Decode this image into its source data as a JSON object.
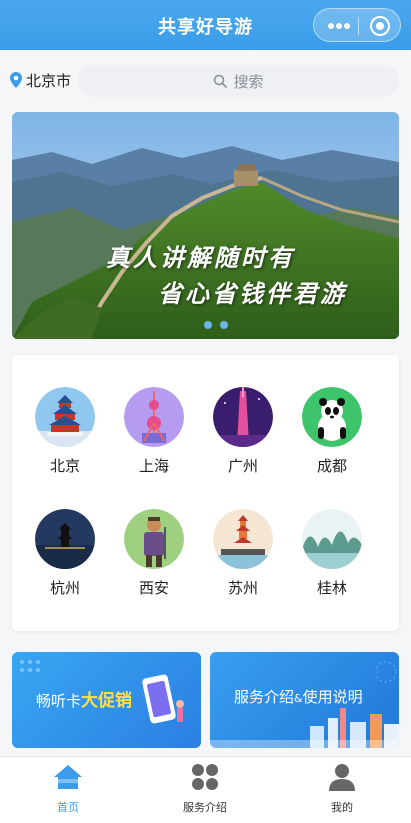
{
  "header": {
    "title": "共享好导游"
  },
  "location": {
    "city": "北京市"
  },
  "search": {
    "placeholder": "搜索"
  },
  "banner": {
    "line1": "真人讲解随时有",
    "line2": "省心省钱伴君游",
    "slides": 2,
    "active_slide": 1
  },
  "cities": [
    {
      "name": "北京",
      "icon": "temple-of-heaven-icon"
    },
    {
      "name": "上海",
      "icon": "oriental-pearl-tower-icon"
    },
    {
      "name": "广州",
      "icon": "canton-tower-icon"
    },
    {
      "name": "成都",
      "icon": "panda-icon"
    },
    {
      "name": "杭州",
      "icon": "leifeng-pagoda-icon"
    },
    {
      "name": "西安",
      "icon": "terracotta-warrior-icon"
    },
    {
      "name": "苏州",
      "icon": "suzhou-pagoda-icon"
    },
    {
      "name": "桂林",
      "icon": "guilin-mountains-icon"
    }
  ],
  "promos": {
    "left": {
      "prefix": "畅听卡",
      "highlight": "大促销"
    },
    "right": {
      "part1": "服务介绍",
      "amp": "&",
      "part2": "使用说明"
    }
  },
  "tabs": [
    {
      "label": "首页",
      "icon": "home-icon",
      "active": true
    },
    {
      "label": "服务介绍",
      "icon": "grid-icon",
      "active": false
    },
    {
      "label": "我的",
      "icon": "user-icon",
      "active": false
    }
  ],
  "colors": {
    "brand": "#3b9de9",
    "highlight": "#ffe048"
  }
}
